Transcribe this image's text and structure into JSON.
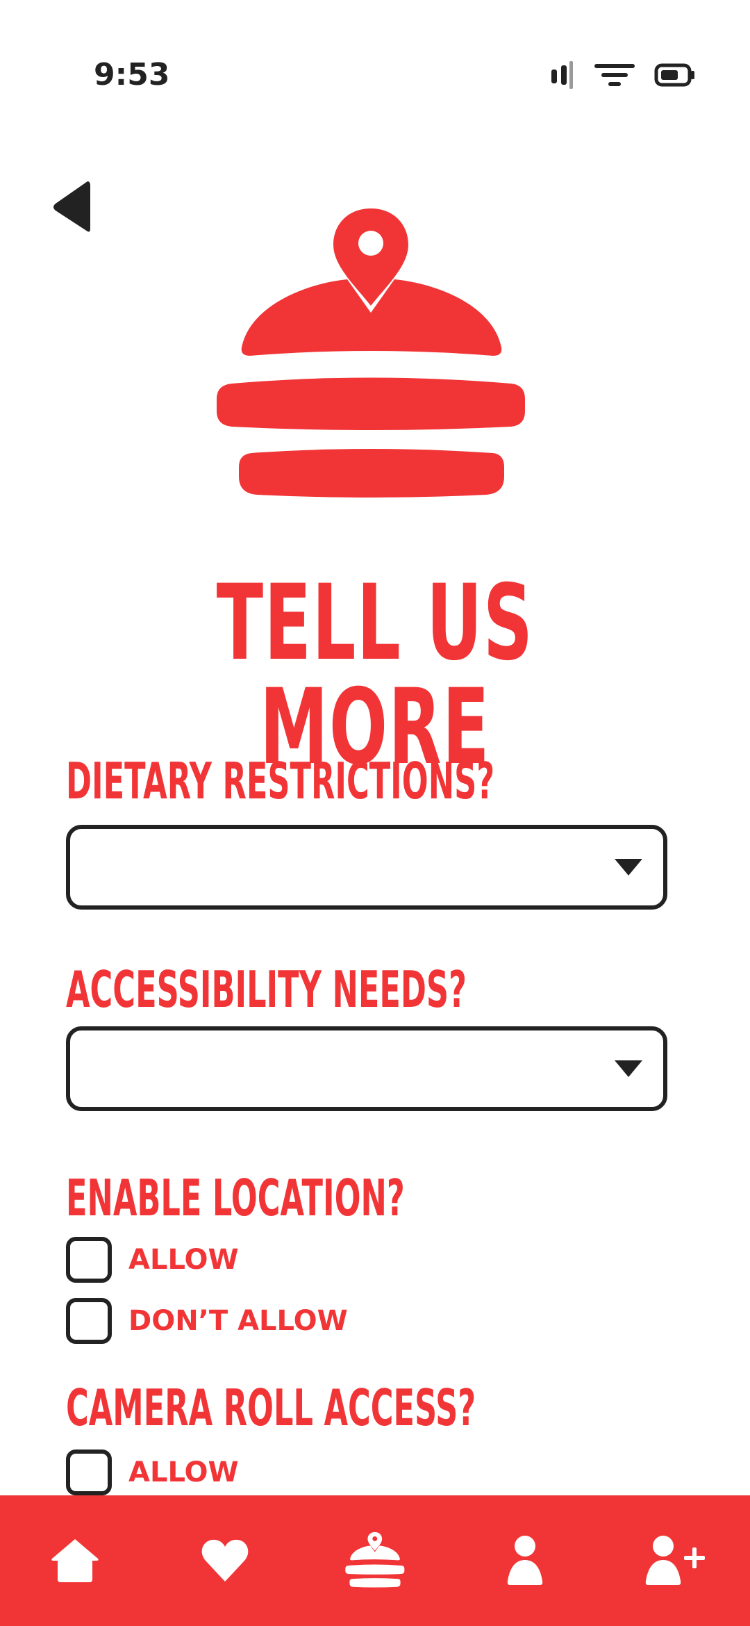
{
  "status_bar": {
    "time": "9:53",
    "icons": [
      "signal-icon",
      "wifi-icon",
      "battery-icon"
    ]
  },
  "page": {
    "title": "TELL US MORE",
    "accent_color": "#f13537"
  },
  "dietary": {
    "label": "DIETARY RESTRICTIONS?",
    "value": ""
  },
  "accessibility": {
    "label": "ACCESSIBILITY NEEDS?",
    "value": ""
  },
  "location": {
    "label": "ENABLE LOCATION?",
    "options": [
      {
        "label": "ALLOW",
        "checked": false
      },
      {
        "label": "DON’T ALLOW",
        "checked": false
      }
    ]
  },
  "camera": {
    "label": "CAMERA ROLL ACCESS?",
    "options": [
      {
        "label": "ALLOW",
        "checked": false
      }
    ]
  },
  "bottom_nav": {
    "items": [
      {
        "icon": "home-icon"
      },
      {
        "icon": "heart-icon"
      },
      {
        "icon": "burger-location-icon",
        "active": true
      },
      {
        "icon": "profile-icon"
      },
      {
        "icon": "add-user-icon"
      }
    ]
  }
}
